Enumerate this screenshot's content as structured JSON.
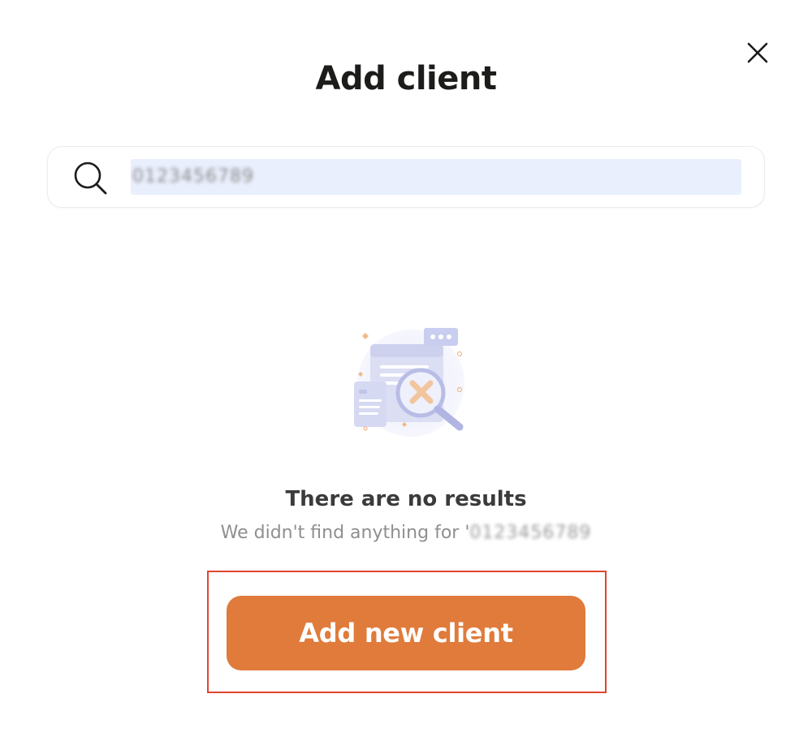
{
  "modal": {
    "title": "Add client",
    "close_icon": "close-icon"
  },
  "search": {
    "icon": "search-icon",
    "value": "0123456789",
    "placeholder": ""
  },
  "empty_state": {
    "illustration_icon": "no-results-illustration-icon",
    "title": "There are no results",
    "subtitle_prefix": "We didn't find anything for '",
    "subtitle_query": "0123456789"
  },
  "actions": {
    "add_new_client_label": "Add new client"
  },
  "colors": {
    "accent": "#e07b3b",
    "highlight_frame": "#e0452f",
    "search_selection": "#e9effd",
    "title_text": "#1c1c1a"
  }
}
